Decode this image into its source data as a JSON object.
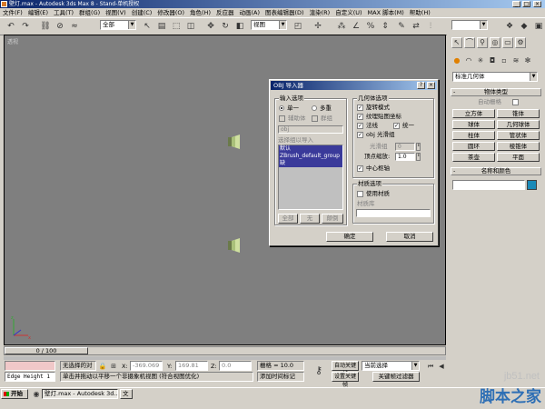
{
  "window": {
    "title": "壁灯.max - Autodesk 3ds Max 8 - Stand-单机授权"
  },
  "menu": [
    "文件(F)",
    "编辑(E)",
    "工具(T)",
    "群组(G)",
    "视图(V)",
    "创建(C)",
    "修改器(O)",
    "角色(H)",
    "反应器",
    "动画(A)",
    "图表编辑器(D)",
    "渲染(R)",
    "自定义(U)",
    "MAX 脚本(M)",
    "帮助(H)"
  ],
  "toolbar": {
    "selection_filter": "全部",
    "coord_system": "视图"
  },
  "viewport": {
    "label": "透视"
  },
  "command_panel": {
    "category_combo": "标准几何体",
    "object_type_title": "物体类型",
    "autogrid_label": "自动栅格",
    "buttons": [
      "立方体",
      "锥体",
      "球体",
      "几何球体",
      "柱体",
      "管状体",
      "圆环",
      "棱锥体",
      "茶壶",
      "平面"
    ],
    "name_color_title": "名称和颜色",
    "swatch_color": "#1a8ab8"
  },
  "dialog": {
    "title": "OBJ 导入器",
    "input_group": "输入选项",
    "single_label": "单一",
    "multi_label": "多重",
    "helper_label": "辅助体",
    "group_label": "群组",
    "field_value": "obj",
    "select_label": "选择组以导入",
    "list_items": [
      "默认",
      "ZBrush_default_group",
      "缺"
    ],
    "all_btn": "全部",
    "none_btn": "无",
    "invert_btn": "颠倒",
    "geometry_group": "几何体选项",
    "rotate_label": "旋转模式",
    "tex_label": "纹理贴图坐标",
    "normals_label": "法线",
    "unify_label": "统一",
    "smooth_label": "obj 光滑组",
    "smooth_group_label": "光滑组",
    "smooth_group_value": "0",
    "vertex_scale_label": "顶点缩放:",
    "vertex_scale_value": "1.0",
    "center_label": "中心枢轴",
    "material_group": "材质选项",
    "use_material_label": "使用材质",
    "material_lib_label": "材质库",
    "ok_btn": "确定",
    "cancel_btn": "取消"
  },
  "timeline": {
    "frame": "0 / 100"
  },
  "status": {
    "maxscript": "Edge Height 1",
    "selection": "无选择的对",
    "x_label": "X:",
    "x_value": "-369.069",
    "y_label": "Y:",
    "y_value": "169.81",
    "z_label": "Z:",
    "z_value": "0.0",
    "grid": "栅格 = 10.0",
    "prompt": "单击并拖动以平移一个非摄象机视图 (符合视图优化)",
    "add_time_tag": "添加时间标记",
    "auto_key": "自动关键帧",
    "set_key": "设置关键帧",
    "key_mode": "当前选择",
    "key_filters": "关键帧过滤器"
  },
  "taskbar": {
    "start": "开始",
    "task1": "壁灯.max - Autodesk 3d...",
    "task2": "文"
  },
  "watermark": {
    "line1": "jb51.net",
    "line2": "脚本之家"
  }
}
